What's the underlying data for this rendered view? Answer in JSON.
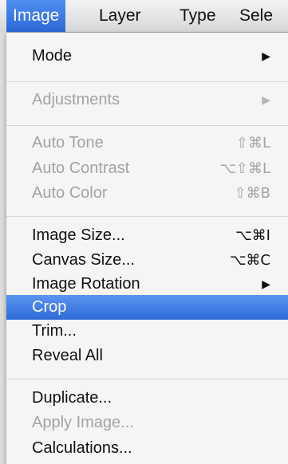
{
  "menubar": {
    "items": [
      {
        "label": "Image"
      },
      {
        "label": "Layer"
      },
      {
        "label": "Type"
      },
      {
        "label": "Sele"
      }
    ]
  },
  "menu": {
    "items": [
      {
        "label": "Mode",
        "submenu_arrow": "▶",
        "enabled": true
      },
      {
        "label": "Adjustments",
        "submenu_arrow": "▶",
        "enabled": false
      },
      {
        "label": "Auto Tone",
        "shortcut": "⇧⌘L",
        "enabled": false
      },
      {
        "label": "Auto Contrast",
        "shortcut": "⌥⇧⌘L",
        "enabled": false
      },
      {
        "label": "Auto Color",
        "shortcut": "⇧⌘B",
        "enabled": false
      },
      {
        "label": "Image Size...",
        "shortcut": "⌥⌘I",
        "enabled": true
      },
      {
        "label": "Canvas Size...",
        "shortcut": "⌥⌘C",
        "enabled": true
      },
      {
        "label": "Image Rotation",
        "submenu_arrow": "▶",
        "enabled": true
      },
      {
        "label": "Crop",
        "enabled": true,
        "highlighted": true
      },
      {
        "label": "Trim...",
        "enabled": true
      },
      {
        "label": "Reveal All",
        "enabled": true
      },
      {
        "label": "Duplicate...",
        "enabled": true
      },
      {
        "label": "Apply Image...",
        "enabled": false
      },
      {
        "label": "Calculations...",
        "enabled": true
      }
    ]
  },
  "colors": {
    "highlight": "#2f6bd8",
    "disabled_text": "#a3a3a3",
    "menu_background": "#f5f5f5"
  }
}
